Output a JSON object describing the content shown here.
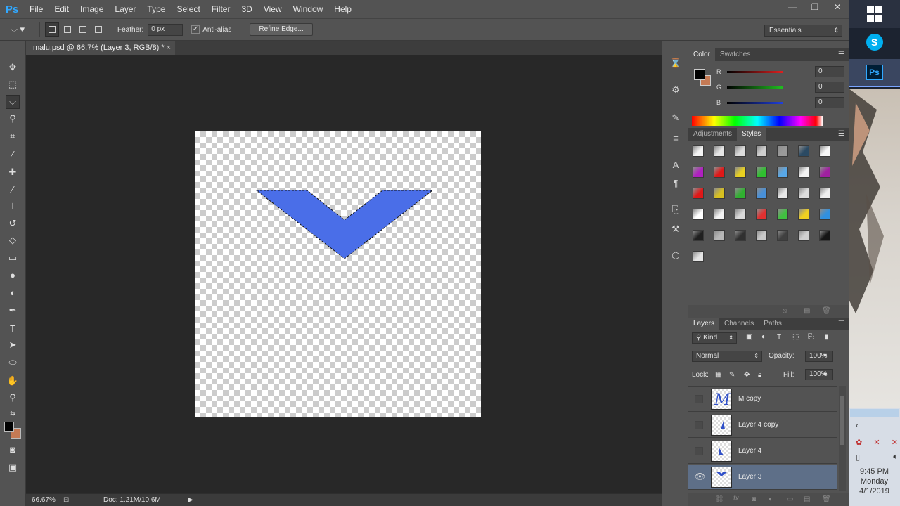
{
  "app": {
    "logo": "Ps",
    "colors": {
      "accent": "#31a8ff",
      "selection_fill": "#4a6ee8",
      "background_swatch": "#c47a55"
    }
  },
  "menu": [
    "File",
    "Edit",
    "Image",
    "Layer",
    "Type",
    "Select",
    "Filter",
    "3D",
    "View",
    "Window",
    "Help"
  ],
  "window_controls": {
    "minimize": "—",
    "restore": "❐",
    "close": "✕"
  },
  "options": {
    "feather_label": "Feather:",
    "feather_value": "0 px",
    "antialias_label": "Anti-alias",
    "antialias_checked": true,
    "refine_edge": "Refine Edge...",
    "workspace": "Essentials"
  },
  "document": {
    "tab_title": "malu.psd @ 66.7% (Layer 3, RGB/8) *",
    "close_glyph": "×"
  },
  "status": {
    "zoom": "66.67%",
    "doc": "Doc: 1.21M/10.6M",
    "arrow": "▶"
  },
  "color_panel": {
    "tabs": [
      "Color",
      "Swatches"
    ],
    "sliders": [
      {
        "label": "R",
        "value": "0",
        "color": "#e02020"
      },
      {
        "label": "G",
        "value": "0",
        "color": "#20c020"
      },
      {
        "label": "B",
        "value": "0",
        "color": "#2040e0"
      }
    ]
  },
  "styles_panel": {
    "tabs": [
      "Adjustments",
      "Styles"
    ],
    "swatch_rows": [
      [
        "#f4f4f4",
        "#e6e6e6",
        "#dcdcdc",
        "#cfcfcf",
        "#9a9a9a",
        "#2b4a63",
        "#f8f8f8"
      ],
      [
        "#b020c0",
        "#e01818",
        "#e8d020",
        "#30c030",
        "#58a8e8",
        "#f4f4f4",
        "#a020a0"
      ],
      [
        "#e01818",
        "#d8c020",
        "#30b030",
        "#4890d8",
        "#e8e8e8",
        "#dddddd",
        "#efefef"
      ],
      [
        "#ffffff",
        "#f2f2f2",
        "#dadada",
        "#e03030",
        "#40c040",
        "#f0d020",
        "#3090e0"
      ],
      [
        "#202020",
        "#b8b8b8",
        "#303030",
        "#c8c8c8",
        "#404040",
        "#d0d0d0",
        "#151515"
      ],
      [
        "#e4e4e4"
      ]
    ]
  },
  "layers_panel": {
    "tabs": [
      "Layers",
      "Channels",
      "Paths"
    ],
    "filter": "Kind",
    "blend_mode": "Normal",
    "opacity_label": "Opacity:",
    "opacity_value": "100%",
    "lock_label": "Lock:",
    "fill_label": "Fill:",
    "fill_value": "100%",
    "layers": [
      {
        "name": "M copy",
        "visible": false,
        "selected": false
      },
      {
        "name": "Layer 4 copy",
        "visible": false,
        "selected": false
      },
      {
        "name": "Layer 4",
        "visible": false,
        "selected": false
      },
      {
        "name": "Layer 3",
        "visible": true,
        "selected": true
      }
    ]
  },
  "taskbar": {
    "time": "9:45 PM",
    "day": "Monday",
    "date": "4/1/2019",
    "ps_label": "Ps",
    "skype_label": "S"
  }
}
